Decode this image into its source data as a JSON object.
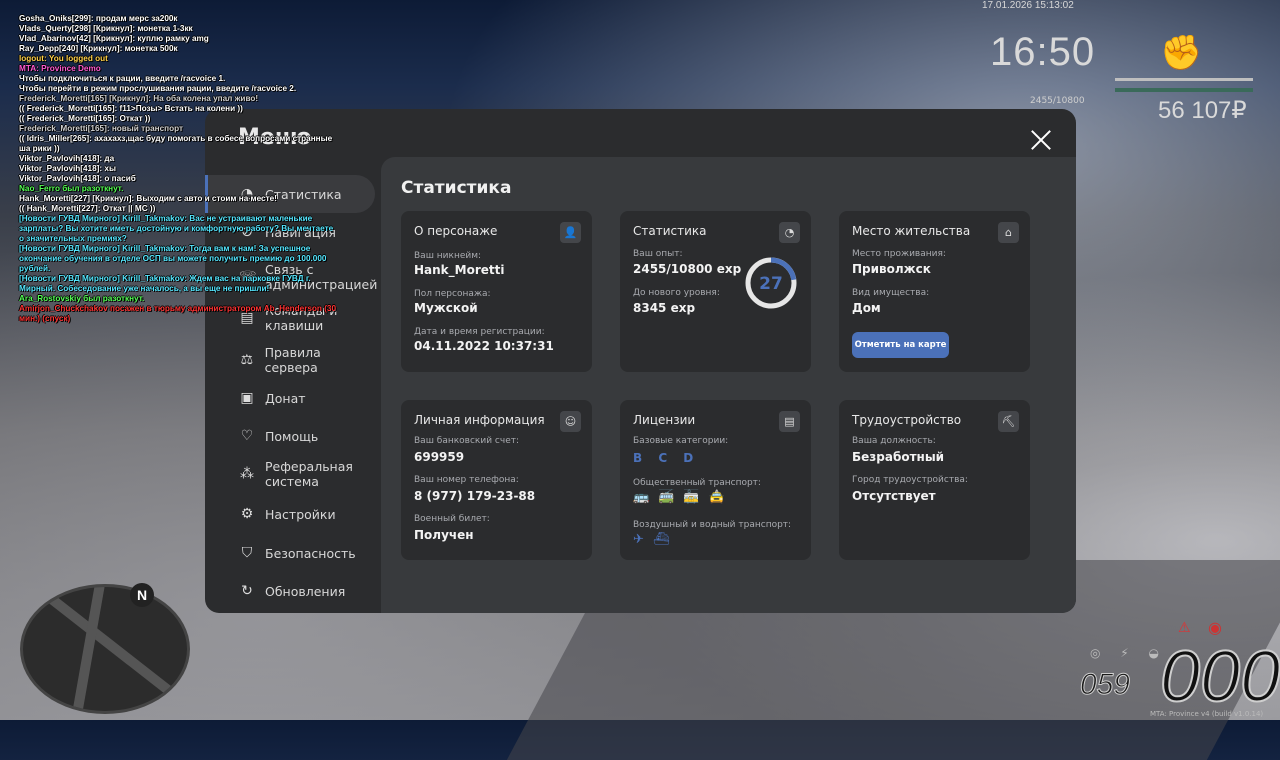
{
  "hud": {
    "datetime": "17.01.2026 15:13:02",
    "clock": "16:50",
    "xp_small": "2455/10800",
    "money": "56 107₽",
    "speed": "000",
    "fuel": "059",
    "north": "N",
    "watermark": "MTA: Province v4 (build v1.0.14)",
    "fist_icon": "fist-icon"
  },
  "chat": [
    {
      "text": "Gosha_Oniks[299]: продам мерс за200к",
      "color": "#ffffff"
    },
    {
      "text": "Vlads_Querty[298] [Крикнул]: монетка 1-3кк",
      "color": "#ffffff"
    },
    {
      "text": "Vlad_Abarinov[42] [Крикнул]: куплю рамку amg",
      "color": "#ffffff"
    },
    {
      "text": "Ray_Depp[240] [Крикнул]: монетка 500к",
      "color": "#ffffff"
    },
    {
      "text": "logout: You logged out",
      "color": "#ffd24a"
    },
    {
      "text": "MTA: Province Demo",
      "color": "#ff5bd3"
    },
    {
      "text": "Чтобы подключиться к рации, введите /racvoice 1.",
      "color": "#ffffff"
    },
    {
      "text": "Чтобы перейти в режим прослушивания рации, введите /racvoice 2.",
      "color": "#ffffff"
    },
    {
      "text": "Frederick_Moretti[165] [Крикнул]: На оба колена упал живо!",
      "color": "#d0d0d0"
    },
    {
      "text": "(( Frederick_Moretti[165]: f11>Позы> Встать на колени ))",
      "color": "#ffffff"
    },
    {
      "text": "(( Frederick_Moretti[165]: Откат ))",
      "color": "#ffffff"
    },
    {
      "text": "Frederick_Moretti[165]: новый транспорт",
      "color": "#d0d0d0"
    },
    {
      "text": "(( Idris_Miller[265]: ахахахз,щас буду помогать в собесе вопросами странные ша рики ))",
      "color": "#ffffff"
    },
    {
      "text": "Viktor_Pavlovih[418]: да",
      "color": "#ffffff"
    },
    {
      "text": "Viktor_Pavlovih[418]: хы",
      "color": "#ffffff"
    },
    {
      "text": "Viktor_Pavlovih[418]: о пасиб",
      "color": "#ffffff"
    },
    {
      "text": "Nao_Ferro был разоткнут.",
      "color": "#55ff55"
    },
    {
      "text": "Hank_Moretti[227] [Крикнул]: Выходим с авто и стоим на месте!",
      "color": "#ffffff"
    },
    {
      "text": "(( Hank_Moretti[227]: Откат || MC ))",
      "color": "#ffffff"
    },
    {
      "text": "[Новости ГУВД Мирного] Kirill_Takmakov: Вас не устраивают маленькие зарплаты? Вы хотите иметь достойную и комфортную работу? Вы мечтаете о значительных премиях?",
      "color": "#55e7ff"
    },
    {
      "text": "[Новости ГУВД Мирного] Kirill_Takmakov: Тогда вам к нам! За успешное окончание обучения в отделе ОСП вы можете получить премию до 100.000 рублей.",
      "color": "#55e7ff"
    },
    {
      "text": "[Новости ГУВД Мирного] Kirill_Takmakov: Ждем вас на парковке ГУВД г. Мирный. Собеседование уже началось, а вы еще не пришли!",
      "color": "#55e7ff"
    },
    {
      "text": "Ara_Rostovskiy был разоткнут.",
      "color": "#55ff55"
    },
    {
      "text": "Amirjon_Chuckchakov посажен в тюрьму администратором Ab_Henderson (30 мин.) (спуск)",
      "color": "#ff3333"
    }
  ],
  "menu": {
    "title": "Меню",
    "side": [
      {
        "label": "Статистика",
        "icon": "pie-chart-icon",
        "name": "statistics"
      },
      {
        "label": "Навигация",
        "icon": "compass-icon",
        "name": "navigation"
      },
      {
        "label": "Связь с\nадминистрацией",
        "icon": "phone-icon",
        "name": "contact-admin"
      },
      {
        "label": "Команды и\nклавиши",
        "icon": "document-icon",
        "name": "commands"
      },
      {
        "label": "Правила сервера",
        "icon": "scales-icon",
        "name": "rules"
      },
      {
        "label": "Донат",
        "icon": "wallet-icon",
        "name": "donate"
      },
      {
        "label": "Помощь",
        "icon": "heart-hand-icon",
        "name": "help"
      },
      {
        "label": "Реферальная\nсистема",
        "icon": "referral-icon",
        "name": "referral"
      },
      {
        "label": "Настройки",
        "icon": "gear-icon",
        "name": "settings"
      },
      {
        "label": "Безопасность",
        "icon": "shield-icon",
        "name": "security"
      },
      {
        "label": "Обновления",
        "icon": "update-icon",
        "name": "updates"
      }
    ],
    "content_title": "Статистика",
    "person": {
      "title": "О персонаже",
      "nick_label": "Ваш никнейм:",
      "nick": "Hank_Moretti",
      "gender_label": "Пол персонажа:",
      "gender": "Мужской",
      "reg_label": "Дата и время регистрации:",
      "reg": "04.11.2022 10:37:31"
    },
    "stats": {
      "title": "Статистика",
      "exp_label": "Ваш опыт:",
      "exp": "2455/10800 exp",
      "next_label": "До нового уровня:",
      "next": "8345 exp",
      "level": "27",
      "progress": 0.227
    },
    "residence": {
      "title": "Место жительства",
      "place_label": "Место проживания:",
      "place": "Приволжск",
      "prop_label": "Вид имущества:",
      "prop": "Дом",
      "button": "Отметить на карте"
    },
    "personal": {
      "title": "Личная информация",
      "bank_label": "Ваш банковский счет:",
      "bank": "699959",
      "phone_label": "Ваш номер телефона:",
      "phone": "8 (977) 179-23-88",
      "military_label": "Военный билет:",
      "military": "Получен"
    },
    "licenses": {
      "title": "Лицензии",
      "base_label": "Базовые категории:",
      "base": "B C D",
      "public_label": "Общественный транспорт:",
      "air_label": "Воздушный и водный транспорт:"
    },
    "job": {
      "title": "Трудоустройство",
      "pos_label": "Ваша должность:",
      "pos": "Безработный",
      "city_label": "Город трудоустройства:",
      "city": "Отсутствует"
    }
  },
  "colors": {
    "accent": "#4b71b9",
    "panel": "#2b2c2e",
    "content": "#383a3d"
  }
}
